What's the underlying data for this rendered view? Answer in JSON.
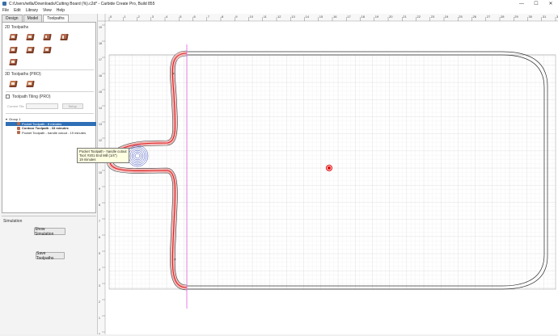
{
  "window": {
    "title": "C:/Users/willa/Downloads/Cutting Board (%).c2d* - Carbide Create Pro, Build 855",
    "minimize": "—",
    "maximize": "☐",
    "close": "✕"
  },
  "menu": {
    "items": [
      "File",
      "Edit",
      "Library",
      "View",
      "Help"
    ]
  },
  "tabs": [
    "Design",
    "Model",
    "Toolpaths"
  ],
  "toolpaths": {
    "section_2d": "2D Toolpaths",
    "section_3d": "3D Toolpaths (PRO)",
    "tiling_label": "Toolpath Tiling (PRO)",
    "current_tile_label": "Current Tile",
    "setup_label": "Setup",
    "tree": [
      {
        "label": "Group 1",
        "selected": false
      },
      {
        "label": "Pocket Toolpath - 8 minutes",
        "selected": true
      },
      {
        "label": "Contour Toolpath - 33 minutes",
        "selected": false
      },
      {
        "label": "Pocket Toolpath - handle cutout - 19 minutes",
        "selected": false
      }
    ]
  },
  "simulation": {
    "title": "Simulation",
    "show_button": "Show Simulation",
    "save_button": "Save Toolpaths"
  },
  "tooltip": {
    "line1": "Pocket Toolpath - handle cutout",
    "line2": "Tool: #201 End Mill (1/4\")",
    "line3": "19 minutes"
  },
  "ruler": {
    "x_labels": [
      "0",
      "1",
      "2",
      "3",
      "4",
      "5",
      "6",
      "7",
      "8",
      "9",
      "10",
      "11",
      "12",
      "13",
      "14",
      "15",
      "16",
      "17",
      "18",
      "19",
      "20",
      "21",
      "22",
      "23",
      "24",
      "25",
      "26",
      "27",
      "28",
      "29",
      "30",
      "31",
      "32"
    ],
    "y_labels": [
      "19",
      "18",
      "17",
      "16",
      "15",
      "14",
      "13",
      "12",
      "11",
      "10",
      "9",
      "8",
      "7",
      "6",
      "5",
      "4",
      "3",
      "2",
      "1",
      "0"
    ]
  },
  "colors": {
    "toolpath_red": "#e02020",
    "guide_magenta": "#e060e0",
    "selection_blue": "#2f6fb5",
    "spiral_blue": "#3344bb"
  }
}
